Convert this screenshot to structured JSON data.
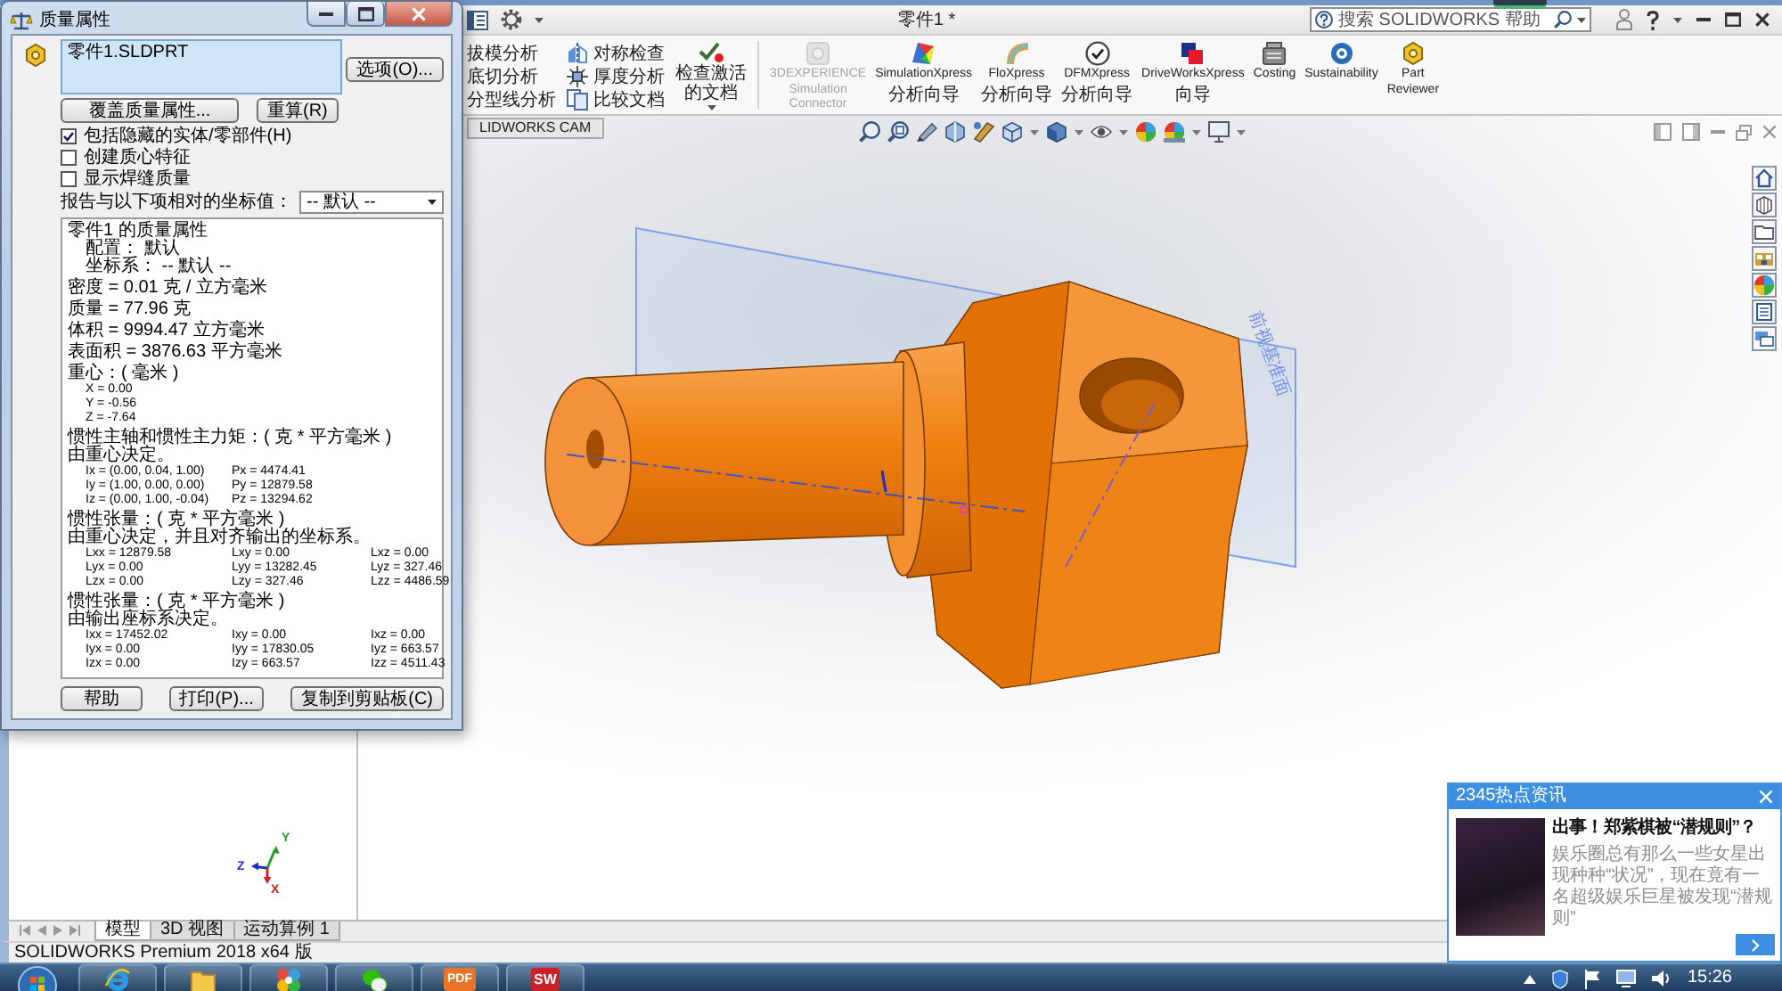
{
  "app_window": {
    "title": "零件1 *",
    "search": {
      "placeholder": "搜索 SOLIDWORKS 帮助"
    }
  },
  "mass_properties_dialog": {
    "title": "质量属性",
    "selection": [
      {
        "label": "零件1.SLDPRT"
      }
    ],
    "options_button": "选项(O)...",
    "override_button": "覆盖质量属性...",
    "recalculate_button": "重算(R)",
    "checkboxes": [
      {
        "label": "包括隐藏的实体/零部件(H)",
        "checked": true
      },
      {
        "label": "创建质心特征",
        "checked": false
      },
      {
        "label": "显示焊缝质量",
        "checked": false
      }
    ],
    "coordinate_system": {
      "label": "报告与以下项相对的坐标值：",
      "value": "-- 默认 --"
    },
    "results": [
      {
        "lines": [
          {
            "kind": "text",
            "text": "零件1 的质量属性"
          },
          {
            "kind": "detail",
            "text": "配置： 默认"
          },
          {
            "kind": "detail",
            "text": "坐标系： -- 默认 --"
          }
        ]
      },
      {
        "lines": [
          {
            "kind": "text",
            "text": "密度 = 0.01 克 / 立方毫米"
          }
        ]
      },
      {
        "lines": [
          {
            "kind": "text",
            "text": "质量 = 77.96 克"
          }
        ]
      },
      {
        "lines": [
          {
            "kind": "text",
            "text": "体积 = 9994.47 立方毫米"
          }
        ]
      },
      {
        "lines": [
          {
            "kind": "text",
            "text": "表面积 = 3876.63 平方毫米"
          }
        ]
      },
      {
        "lines": [
          {
            "kind": "text",
            "text": "重心：( 毫米 )"
          },
          {
            "kind": "values",
            "cells": [
              "X = 0.00"
            ]
          },
          {
            "kind": "values",
            "cells": [
              "Y = -0.56"
            ]
          },
          {
            "kind": "values",
            "cells": [
              "Z = -7.64"
            ]
          }
        ]
      },
      {
        "lines": [
          {
            "kind": "text",
            "text": "惯性主轴和惯性主力矩：( 克 * 平方毫米 )"
          },
          {
            "kind": "text",
            "text": "由重心决定。"
          },
          {
            "kind": "values",
            "cells": [
              "Ix = (0.00, 0.04, 1.00)",
              "Px = 4474.41"
            ]
          },
          {
            "kind": "values",
            "cells": [
              "Iy = (1.00, 0.00, 0.00)",
              "Py = 12879.58"
            ]
          },
          {
            "kind": "values",
            "cells": [
              "Iz = (0.00, 1.00, -0.04)",
              "Pz = 13294.62"
            ]
          }
        ]
      },
      {
        "lines": [
          {
            "kind": "text",
            "text": "惯性张量：( 克 * 平方毫米 )"
          },
          {
            "kind": "text",
            "text": "由重心决定，并且对齐输出的坐标系。"
          },
          {
            "kind": "values",
            "cells": [
              "Lxx = 12879.58",
              "Lxy = 0.00",
              "Lxz = 0.00"
            ]
          },
          {
            "kind": "values",
            "cells": [
              "Lyx = 0.00",
              "Lyy = 13282.45",
              "Lyz = 327.46"
            ]
          },
          {
            "kind": "values",
            "cells": [
              "Lzx = 0.00",
              "Lzy = 327.46",
              "Lzz = 4486.59"
            ]
          }
        ]
      },
      {
        "lines": [
          {
            "kind": "text",
            "text": "惯性张量：( 克 * 平方毫米 )"
          },
          {
            "kind": "text",
            "text": "由输出座标系决定。"
          },
          {
            "kind": "values",
            "cells": [
              "Ixx = 17452.02",
              "Ixy = 0.00",
              "Ixz = 0.00"
            ]
          },
          {
            "kind": "values",
            "cells": [
              "Iyx = 0.00",
              "Iyy = 17830.05",
              "Iyz = 663.57"
            ]
          },
          {
            "kind": "values",
            "cells": [
              "Izx = 0.00",
              "Izy = 663.57",
              "Izz = 4511.43"
            ]
          }
        ]
      }
    ],
    "buttons": [
      {
        "label": "帮助"
      },
      {
        "label": "打印(P)..."
      },
      {
        "label": "复制到剪贴板(C)"
      }
    ]
  },
  "ribbon": {
    "column_1": [
      {
        "label": "拔模分析"
      },
      {
        "label": "底切分析"
      },
      {
        "label": "分型线分析"
      }
    ],
    "column_2": [
      {
        "label": "对称检查"
      },
      {
        "label": "厚度分析"
      },
      {
        "label": "比较文档"
      }
    ],
    "check_document": {
      "label": "检查激活的文档"
    },
    "tools": [
      {
        "title": "3DEXPERIENCE Simulation Connector",
        "disabled": true
      },
      {
        "title": "SimulationXpress",
        "subtitle": "分析向导",
        "disabled": false
      },
      {
        "title": "FloXpress",
        "subtitle": "分析向导",
        "disabled": false
      },
      {
        "title": "DFMXpress",
        "subtitle": "分析向导",
        "disabled": false
      },
      {
        "title": "DriveWorksXpress",
        "subtitle": "向导",
        "disabled": false
      },
      {
        "title": "Costing",
        "disabled": false
      },
      {
        "title": "Sustainability",
        "disabled": false
      },
      {
        "title": "Part Reviewer",
        "disabled": false
      }
    ]
  },
  "command_tabs": [
    {
      "label": "LIDWORKS CAM"
    }
  ],
  "viewport": {
    "plane_label": "前视基准面",
    "triad_axes": [
      "Y",
      "Z",
      "X"
    ]
  },
  "model_tabs": [
    {
      "label": "模型",
      "selected": true
    },
    {
      "label": "3D 视图",
      "selected": false
    },
    {
      "label": "运动算例 1",
      "selected": false
    }
  ],
  "status_bar": {
    "text": "SOLIDWORKS Premium 2018 x64 版"
  },
  "news_popup": {
    "header": "2345热点资讯",
    "headline": "出事！郑紫棋被“潜规则”？",
    "body": "娱乐圈总有那么一些女星出现种种“状况”，现在竟有一名超级娱乐巨星被发现“潜规则”"
  },
  "taskbar": {
    "icon_texts": [
      "PDF",
      "SW"
    ],
    "clock": "15:26"
  }
}
